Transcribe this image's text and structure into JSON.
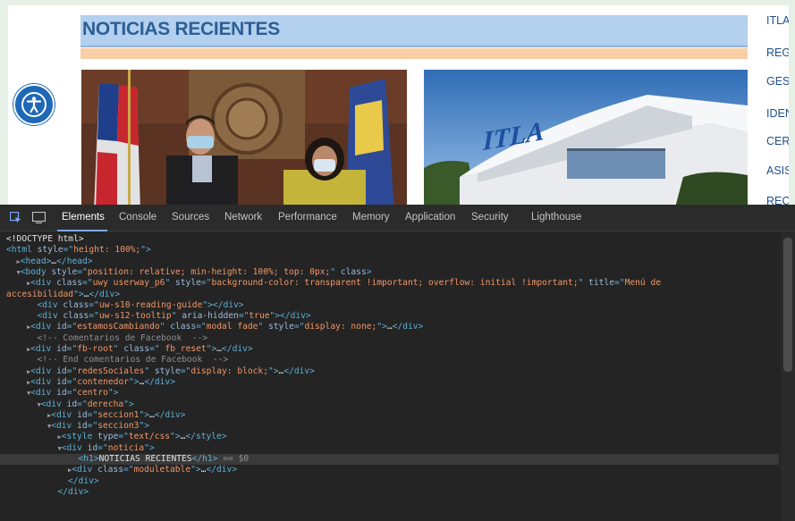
{
  "site": {
    "news_title": "NOTICIAS RECIENTES",
    "side_menu": [
      "ITLA",
      "REG",
      "GES",
      "IDEN",
      "CERT",
      "ASIS",
      "REC"
    ],
    "accessibility_label": "Menú de accesibilidad",
    "photo_right_logo": "ITLA"
  },
  "devtools": {
    "tabs": [
      "Elements",
      "Console",
      "Sources",
      "Network",
      "Performance",
      "Memory",
      "Application",
      "Security",
      "Lighthouse"
    ],
    "active_tab": "Elements",
    "dom_lines": [
      {
        "indent": 0,
        "tri": "",
        "parts": [
          [
            "txt",
            "<!DOCTYPE html>"
          ]
        ]
      },
      {
        "indent": 0,
        "tri": "",
        "parts": [
          [
            "tag",
            "<html "
          ],
          [
            "attr",
            "style"
          ],
          [
            "tag",
            "=\""
          ],
          [
            "aval",
            "height: 100%;"
          ],
          [
            "tag",
            "\">"
          ]
        ]
      },
      {
        "indent": 1,
        "tri": "▶",
        "parts": [
          [
            "tag",
            "<head>"
          ],
          [
            "txt",
            "…"
          ],
          [
            "tag",
            "</head>"
          ]
        ]
      },
      {
        "indent": 1,
        "tri": "▼",
        "parts": [
          [
            "tag",
            "<body "
          ],
          [
            "attr",
            "style"
          ],
          [
            "tag",
            "=\""
          ],
          [
            "aval",
            "position: relative; min-height: 100%; top: 0px;"
          ],
          [
            "tag",
            "\" "
          ],
          [
            "attr",
            "class"
          ],
          [
            "tag",
            ">"
          ]
        ]
      },
      {
        "indent": 2,
        "tri": "▶",
        "parts": [
          [
            "tag",
            "<div "
          ],
          [
            "attr",
            "class"
          ],
          [
            "tag",
            "=\""
          ],
          [
            "aval",
            "uwy userway_p6"
          ],
          [
            "tag",
            "\" "
          ],
          [
            "attr",
            "style"
          ],
          [
            "tag",
            "=\""
          ],
          [
            "aval",
            "background-color: transparent !important; overflow: initial !important;"
          ],
          [
            "tag",
            "\" "
          ],
          [
            "attr",
            "title"
          ],
          [
            "tag",
            "=\""
          ],
          [
            "aval",
            "Menú de"
          ]
        ]
      },
      {
        "indent": 0,
        "tri": "",
        "parts": [
          [
            "aval",
            "accesibilidad"
          ],
          [
            "tag",
            "\">"
          ],
          [
            "txt",
            "…"
          ],
          [
            "tag",
            "</div>"
          ]
        ]
      },
      {
        "indent": 3,
        "tri": "",
        "parts": [
          [
            "tag",
            "<div "
          ],
          [
            "attr",
            "class"
          ],
          [
            "tag",
            "=\""
          ],
          [
            "aval",
            "uw-s10-reading-guide"
          ],
          [
            "tag",
            "\"></div>"
          ]
        ]
      },
      {
        "indent": 3,
        "tri": "",
        "parts": [
          [
            "tag",
            "<div "
          ],
          [
            "attr",
            "class"
          ],
          [
            "tag",
            "=\""
          ],
          [
            "aval",
            "uw-s12-tooltip"
          ],
          [
            "tag",
            "\" "
          ],
          [
            "attr",
            "aria-hidden"
          ],
          [
            "tag",
            "=\""
          ],
          [
            "aval",
            "true"
          ],
          [
            "tag",
            "\"></div>"
          ]
        ]
      },
      {
        "indent": 2,
        "tri": "▶",
        "parts": [
          [
            "tag",
            "<div "
          ],
          [
            "attr",
            "id"
          ],
          [
            "tag",
            "=\""
          ],
          [
            "aval",
            "estamosCambiando"
          ],
          [
            "tag",
            "\" "
          ],
          [
            "attr",
            "class"
          ],
          [
            "tag",
            "=\""
          ],
          [
            "aval",
            "modal fade"
          ],
          [
            "tag",
            "\" "
          ],
          [
            "attr",
            "style"
          ],
          [
            "tag",
            "=\""
          ],
          [
            "aval",
            "display: none;"
          ],
          [
            "tag",
            "\">"
          ],
          [
            "txt",
            "…"
          ],
          [
            "tag",
            "</div>"
          ]
        ]
      },
      {
        "indent": 3,
        "tri": "",
        "parts": [
          [
            "cmt",
            "<!-- Comentarios de Facebook  -->"
          ]
        ]
      },
      {
        "indent": 2,
        "tri": "▶",
        "parts": [
          [
            "tag",
            "<div "
          ],
          [
            "attr",
            "id"
          ],
          [
            "tag",
            "=\""
          ],
          [
            "aval",
            "fb-root"
          ],
          [
            "tag",
            "\" "
          ],
          [
            "attr",
            "class"
          ],
          [
            "tag",
            "=\""
          ],
          [
            "aval",
            " fb_reset"
          ],
          [
            "tag",
            "\">"
          ],
          [
            "txt",
            "…"
          ],
          [
            "tag",
            "</div>"
          ]
        ]
      },
      {
        "indent": 3,
        "tri": "",
        "parts": [
          [
            "cmt",
            "<!-- End comentarios de Facebook  -->"
          ]
        ]
      },
      {
        "indent": 2,
        "tri": "▶",
        "parts": [
          [
            "tag",
            "<div "
          ],
          [
            "attr",
            "id"
          ],
          [
            "tag",
            "=\""
          ],
          [
            "aval",
            "redesSociales"
          ],
          [
            "tag",
            "\" "
          ],
          [
            "attr",
            "style"
          ],
          [
            "tag",
            "=\""
          ],
          [
            "aval",
            "display: block;"
          ],
          [
            "tag",
            "\">"
          ],
          [
            "txt",
            "…"
          ],
          [
            "tag",
            "</div>"
          ]
        ]
      },
      {
        "indent": 2,
        "tri": "▶",
        "parts": [
          [
            "tag",
            "<div "
          ],
          [
            "attr",
            "id"
          ],
          [
            "tag",
            "=\""
          ],
          [
            "aval",
            "contenedor"
          ],
          [
            "tag",
            "\">"
          ],
          [
            "txt",
            "…"
          ],
          [
            "tag",
            "</div>"
          ]
        ]
      },
      {
        "indent": 2,
        "tri": "▼",
        "parts": [
          [
            "tag",
            "<div "
          ],
          [
            "attr",
            "id"
          ],
          [
            "tag",
            "=\""
          ],
          [
            "aval",
            "centro"
          ],
          [
            "tag",
            "\">"
          ]
        ]
      },
      {
        "indent": 3,
        "tri": "▼",
        "parts": [
          [
            "tag",
            "<div "
          ],
          [
            "attr",
            "id"
          ],
          [
            "tag",
            "=\""
          ],
          [
            "aval",
            "derecha"
          ],
          [
            "tag",
            "\">"
          ]
        ]
      },
      {
        "indent": 4,
        "tri": "▶",
        "parts": [
          [
            "tag",
            "<div "
          ],
          [
            "attr",
            "id"
          ],
          [
            "tag",
            "=\""
          ],
          [
            "aval",
            "seccion1"
          ],
          [
            "tag",
            "\">"
          ],
          [
            "txt",
            "…"
          ],
          [
            "tag",
            "</div>"
          ]
        ]
      },
      {
        "indent": 4,
        "tri": "▼",
        "parts": [
          [
            "tag",
            "<div "
          ],
          [
            "attr",
            "id"
          ],
          [
            "tag",
            "=\""
          ],
          [
            "aval",
            "seccion3"
          ],
          [
            "tag",
            "\">"
          ]
        ]
      },
      {
        "indent": 5,
        "tri": "▶",
        "parts": [
          [
            "tag",
            "<style "
          ],
          [
            "attr",
            "type"
          ],
          [
            "tag",
            "=\""
          ],
          [
            "aval",
            "text/css"
          ],
          [
            "tag",
            "\">"
          ],
          [
            "txt",
            "…"
          ],
          [
            "tag",
            "</style>"
          ]
        ]
      },
      {
        "indent": 5,
        "tri": "▼",
        "parts": [
          [
            "tag",
            "<div "
          ],
          [
            "attr",
            "id"
          ],
          [
            "tag",
            "=\""
          ],
          [
            "aval",
            "noticia"
          ],
          [
            "tag",
            "\">"
          ]
        ]
      },
      {
        "indent": 7,
        "tri": "",
        "selected": true,
        "parts": [
          [
            "tag",
            "<h1>"
          ],
          [
            "txt",
            "NOTICIAS RECIENTES"
          ],
          [
            "tag",
            "</h1>"
          ],
          [
            "cmt",
            " == $0"
          ]
        ]
      },
      {
        "indent": 6,
        "tri": "▶",
        "parts": [
          [
            "tag",
            "<div "
          ],
          [
            "attr",
            "class"
          ],
          [
            "tag",
            "=\""
          ],
          [
            "aval",
            "moduletable"
          ],
          [
            "tag",
            "\">"
          ],
          [
            "txt",
            "…"
          ],
          [
            "tag",
            "</div>"
          ]
        ]
      },
      {
        "indent": 6,
        "tri": "",
        "parts": [
          [
            "tag",
            "</div>"
          ]
        ]
      },
      {
        "indent": 5,
        "tri": "",
        "parts": [
          [
            "tag",
            "</div>"
          ]
        ]
      }
    ]
  },
  "colors": {
    "header_bg": "#b3d0ee",
    "header_text": "#2d5f96",
    "subbar": "#f8cea4",
    "a11y_button": "#1e68b8",
    "devtools_bg": "#242424"
  }
}
